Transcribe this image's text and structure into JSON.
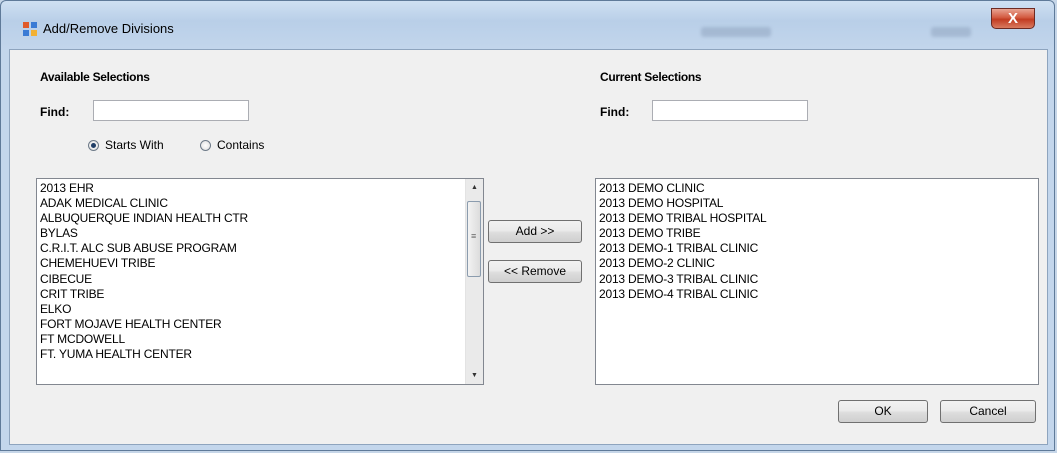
{
  "window": {
    "title": "Add/Remove Divisions",
    "close_glyph": "X",
    "icon": "window-app-icon"
  },
  "available": {
    "heading": "Available Selections",
    "find_label": "Find:",
    "find_value": "",
    "radio_starts_with": "Starts With",
    "radio_contains": "Contains",
    "selected_mode": "Starts With",
    "items": [
      "2013 EHR",
      "ADAK MEDICAL CLINIC",
      "ALBUQUERQUE INDIAN HEALTH CTR",
      "BYLAS",
      "C.R.I.T. ALC SUB ABUSE PROGRAM",
      "CHEMEHUEVI TRIBE",
      "CIBECUE",
      "CRIT TRIBE",
      "ELKO",
      "FORT MOJAVE HEALTH CENTER",
      "FT MCDOWELL",
      "FT. YUMA HEALTH CENTER"
    ]
  },
  "current": {
    "heading": "Current Selections",
    "find_label": "Find:",
    "find_value": "",
    "items": [
      "2013 DEMO CLINIC",
      "2013 DEMO HOSPITAL",
      "2013 DEMO TRIBAL HOSPITAL",
      "2013 DEMO TRIBE",
      "2013 DEMO-1 TRIBAL CLINIC",
      "2013 DEMO-2 CLINIC",
      "2013 DEMO-3 TRIBAL CLINIC",
      "2013 DEMO-4 TRIBAL CLINIC"
    ]
  },
  "buttons": {
    "add": "Add >>",
    "remove": "<< Remove",
    "ok": "OK",
    "cancel": "Cancel"
  }
}
